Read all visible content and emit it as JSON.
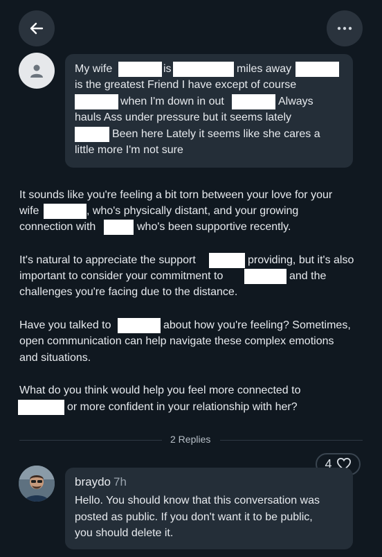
{
  "header": {
    "back_icon": "arrow-left-icon",
    "more_icon": "more-horizontal-icon"
  },
  "user_message": {
    "avatar_icon": "person-icon",
    "lines": [
      [
        "My wife",
        "is",
        "miles away"
      ],
      [
        "is the greatest Friend I have except of course"
      ],
      [
        "when I'm down in out",
        "Always"
      ],
      [
        "hauls Ass under pressure but it seems  lately"
      ],
      [
        "Been here Lately it seems like she cares a"
      ],
      [
        "little more I'm not sure"
      ]
    ]
  },
  "ai_response": {
    "paragraph1": [
      "It sounds like you're feeling a bit torn between your love for your",
      "wife",
      ", who's physically distant, and your growing",
      "connection with",
      "who's been supportive recently."
    ],
    "paragraph2": [
      "It's natural to appreciate the support",
      "providing, but it's also",
      "important to consider your commitment to",
      "and the",
      "challenges you're facing due to the distance."
    ],
    "paragraph3": [
      "Have you talked to",
      "about how you're feeling? Sometimes,",
      "open communication can help navigate these complex emotions",
      "and situations."
    ],
    "paragraph4": [
      "What do you think would help you feel more connected to",
      "or more confident in your relationship with her?"
    ]
  },
  "replies": {
    "label": "2 Replies"
  },
  "reply": {
    "like_count": "4",
    "like_icon": "heart-icon",
    "author": "braydo",
    "time": "7h",
    "lines": [
      "Hello. You should know that this conversation was",
      "posted as public. If you don't want it to be public,",
      "you should delete it."
    ]
  },
  "colors": {
    "background": "#101820",
    "bubble": "#242e38",
    "text": "#e7eaee",
    "redaction": "#ffffff"
  }
}
